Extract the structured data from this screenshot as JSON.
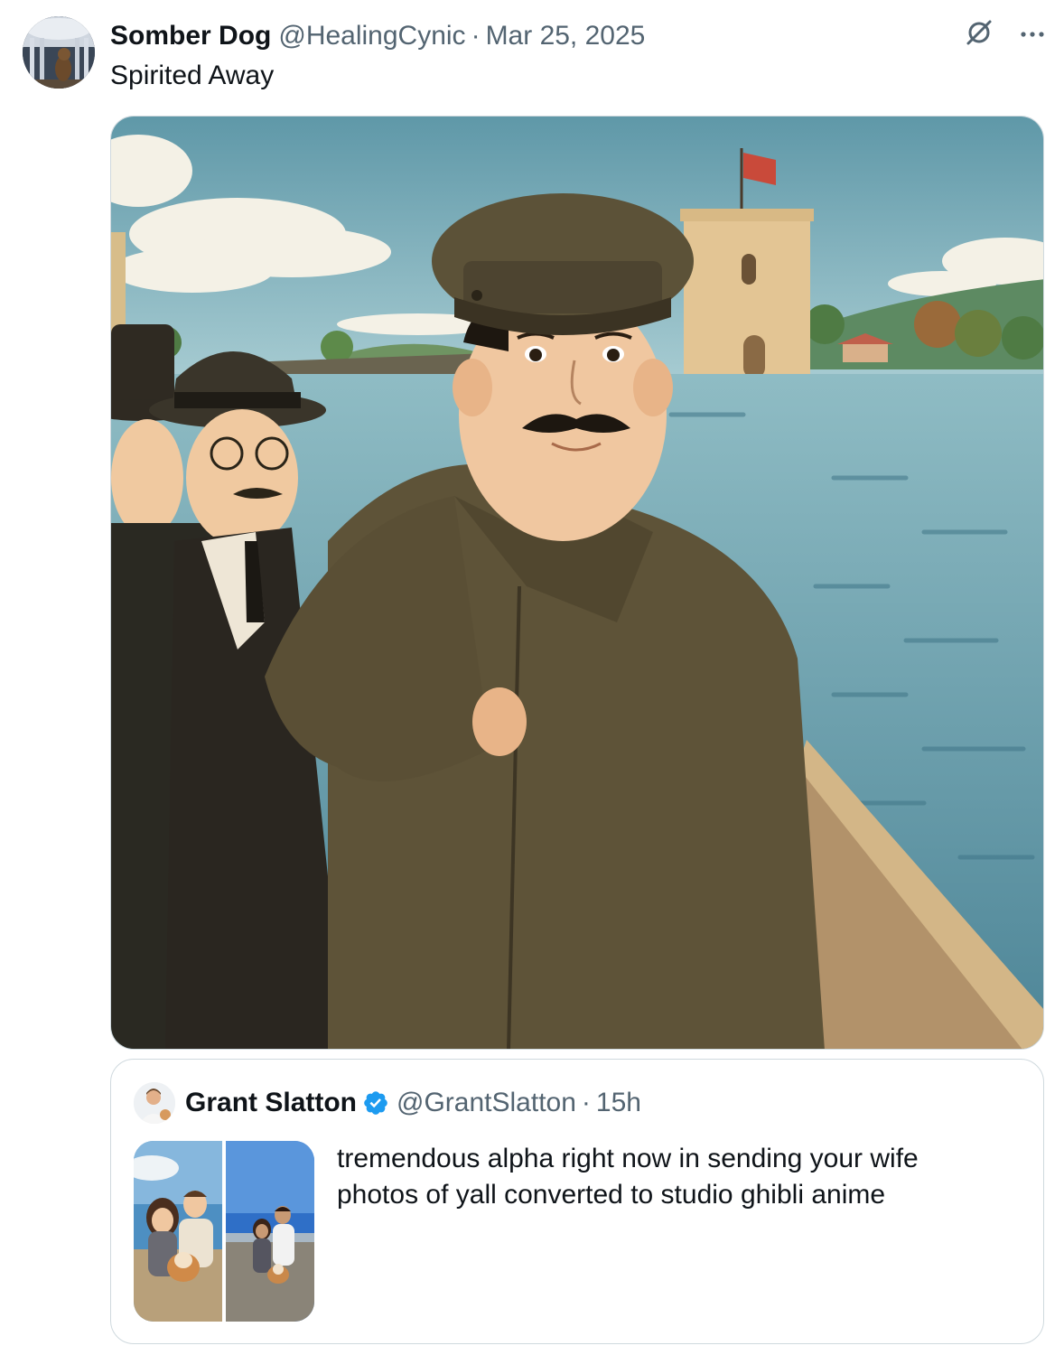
{
  "post": {
    "author": {
      "display_name": "Somber Dog",
      "handle": "@HealingCynic",
      "date": "Mar 25, 2025"
    },
    "separator": "·",
    "text": "Spirited Away",
    "icons": [
      "grok-icon",
      "more-options-icon"
    ],
    "media": {
      "kind": "image"
    }
  },
  "quoted_post": {
    "author": {
      "display_name": "Grant Slatton",
      "handle": "@GrantSlatton",
      "time": "15h",
      "verified": true
    },
    "separator": "·",
    "text": "tremendous alpha right now in sending your wife photos of yall converted to studio ghibli anime",
    "thumbnail_count": 2
  },
  "colors": {
    "primary_text": "#0f1419",
    "secondary_text": "#536471",
    "border": "#cfd9de",
    "verified_blue": "#1d9bf0"
  }
}
